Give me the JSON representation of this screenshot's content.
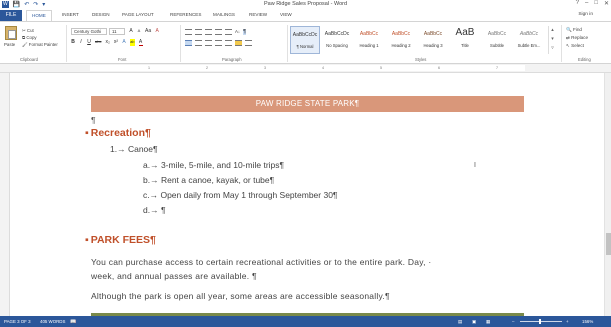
{
  "window": {
    "title": "Paw Ridge Sales Proposal - Word",
    "minimize": "–",
    "maximize": "□",
    "close": "✕",
    "help": "?"
  },
  "quick_access": {
    "save": "💾",
    "undo": "↶",
    "redo": "↷",
    "customize": "▾"
  },
  "tabs": {
    "file": "FILE",
    "home": "HOME",
    "insert": "INSERT",
    "design": "DESIGN",
    "page_layout": "PAGE LAYOUT",
    "references": "REFERENCES",
    "mailings": "MAILINGS",
    "review": "REVIEW",
    "view": "VIEW",
    "sign_in": "Sign in"
  },
  "ribbon": {
    "clipboard": {
      "paste": "Paste",
      "cut": "Cut",
      "copy": "Copy",
      "format_painter": "Format Painter",
      "label": "Clipboard"
    },
    "font": {
      "font_name": "Century Gothi",
      "font_size": "11",
      "row1": [
        "A",
        "A",
        "Aa",
        "A"
      ],
      "row2": [
        "B",
        "I",
        "U",
        "abc",
        "x₂",
        "x²",
        "A",
        "ab",
        "A"
      ],
      "label": "Font"
    },
    "paragraph": {
      "label": "Paragraph",
      "pilcrow": "¶",
      "sort": "A↓"
    },
    "styles": {
      "label": "Styles",
      "items": [
        {
          "sample": "AaBbCcDc",
          "name": "¶ Normal"
        },
        {
          "sample": "AaBbCcDc",
          "name": "No Spacing"
        },
        {
          "sample": "AaBbCc",
          "name": "Heading 1"
        },
        {
          "sample": "AaBbCc",
          "name": "Heading 2"
        },
        {
          "sample": "AaBbCc",
          "name": "Heading 3"
        },
        {
          "sample": "AaB",
          "name": "Title"
        },
        {
          "sample": "AaBbCc",
          "name": "Subtitle"
        },
        {
          "sample": "AaBbCc",
          "name": "Subtle Em..."
        }
      ]
    },
    "editing": {
      "find": "Find",
      "replace": "Replace",
      "select": "Select",
      "label": "Editing"
    }
  },
  "ruler": {
    "ticks": [
      "1",
      "2",
      "3",
      "4",
      "5",
      "6",
      "7"
    ]
  },
  "document": {
    "banner": "PAW RIDGE STATE PARK¶",
    "empty_para": "¶",
    "heading_recreation": "Recreation¶",
    "list_1": "1.→ Canoe¶",
    "list_a": "a.→ 3-mile, 5-mile, and 10-mile trips¶",
    "list_b": "b.→ Rent a canoe, kayak, or tube¶",
    "list_c": "c.→ Open daily from May 1 through September 30¶",
    "list_d": "d.→ ¶",
    "heading_fees": "PARK FEES¶",
    "body_1_line1": "You can purchase access to certain recreational activities or to the entire park. Day, ·",
    "body_1_line2": "week, and annual passes are available. ¶",
    "body_2": "Although the park is open all year, some areas are accessible seasonally.¶"
  },
  "status": {
    "page": "PAGE 3 OF 3",
    "words": "405 WORDS",
    "zoom": "156%",
    "zoom_minus": "–",
    "zoom_plus": "+"
  }
}
